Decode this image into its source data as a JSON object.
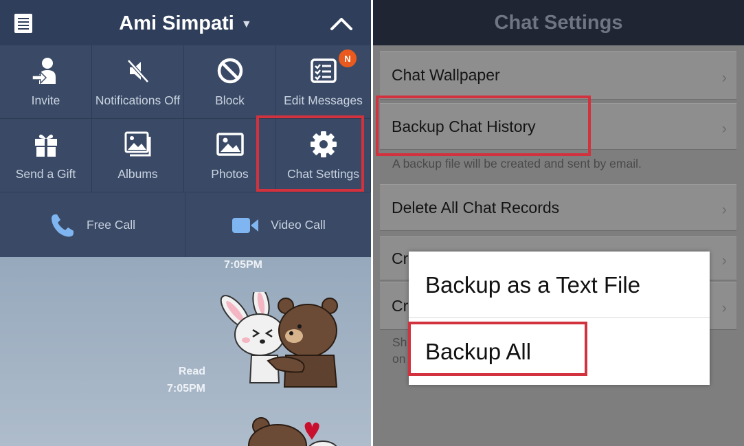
{
  "chat_menu": {
    "contact_name": "Ami Simpati",
    "items": [
      {
        "label": "Invite",
        "icon": "invite-person-icon"
      },
      {
        "label": "Notifications Off",
        "icon": "speaker-muted-icon"
      },
      {
        "label": "Block",
        "icon": "block-icon"
      },
      {
        "label": "Edit Messages",
        "icon": "checklist-icon",
        "badge": "N"
      },
      {
        "label": "Send a Gift",
        "icon": "gift-icon"
      },
      {
        "label": "Albums",
        "icon": "albums-icon"
      },
      {
        "label": "Photos",
        "icon": "photo-icon"
      },
      {
        "label": "Chat Settings",
        "icon": "gear-icon"
      }
    ],
    "calls": [
      {
        "label": "Free Call",
        "icon": "phone-icon"
      },
      {
        "label": "Video Call",
        "icon": "video-camera-icon"
      }
    ]
  },
  "chat": {
    "time_top": "7:05PM",
    "read_label": "Read",
    "time_read": "7:05PM"
  },
  "settings": {
    "title": "Chat Settings",
    "rows": [
      {
        "label": "Chat Wallpaper"
      },
      {
        "label": "Backup Chat History"
      },
      {
        "label": "Delete All Chat Records"
      },
      {
        "label": "Cr"
      },
      {
        "label": "Cr"
      }
    ],
    "backup_hint": "A backup file will be created and sent by email.",
    "partial_hint_1": "Sh",
    "partial_hint_2": "on"
  },
  "backup_dialog": {
    "options": [
      "Backup as a Text File",
      "Backup All"
    ]
  },
  "colors": {
    "highlight": "#d2323d",
    "badge": "#ea5a1e",
    "topbar": "#2f3e5a",
    "menu_bg": "#3a4a66",
    "call_icon": "#7fb6f2"
  }
}
